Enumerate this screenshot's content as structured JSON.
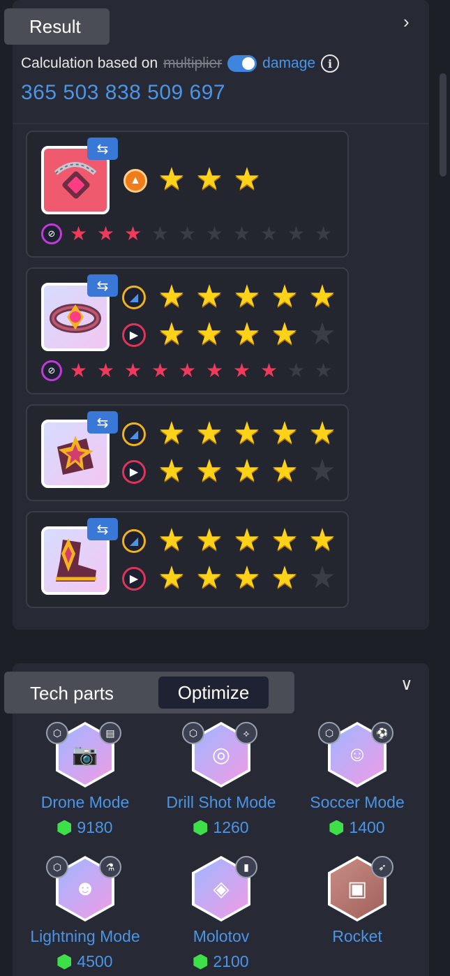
{
  "result": {
    "title": "Result",
    "calc_prefix": "Calculation based on",
    "calc_option_off": "multiplier",
    "calc_option_on": "damage",
    "info_icon": "i",
    "total": "365 503 838 509 697"
  },
  "items": [
    {
      "name": "chain-pendant",
      "stars_main": 3,
      "main_attr_icon": "fire-icon",
      "rows": [
        {
          "attr_icon": "flame-attr-icon",
          "filled": 3,
          "max": 3
        }
      ],
      "sub_stars": {
        "filled": 3,
        "max": 10
      }
    },
    {
      "name": "jeweled-collar",
      "rows": [
        {
          "attr_icon": "blade-attr-icon",
          "filled": 5,
          "max": 5
        },
        {
          "attr_icon": "speed-attr-icon",
          "filled": 4,
          "max": 5
        }
      ],
      "sub_stars": {
        "filled": 8,
        "max": 10
      }
    },
    {
      "name": "star-gauntlet",
      "rows": [
        {
          "attr_icon": "blade-attr-icon",
          "filled": 5,
          "max": 5
        },
        {
          "attr_icon": "speed-attr-icon",
          "filled": 4,
          "max": 5
        }
      ]
    },
    {
      "name": "winged-boot",
      "rows": [
        {
          "attr_icon": "blade-attr-icon",
          "filled": 5,
          "max": 5
        },
        {
          "attr_icon": "speed-attr-icon",
          "filled": 4,
          "max": 5
        }
      ]
    }
  ],
  "swap_symbol": "⇆",
  "tech": {
    "title": "Tech parts",
    "optimize_label": "Optimize",
    "parts": [
      {
        "name": "Drone Mode",
        "cost": "9180",
        "glyph": "📷",
        "badge": "▤"
      },
      {
        "name": "Drill Shot Mode",
        "cost": "1260",
        "glyph": "◎",
        "badge": "⟡"
      },
      {
        "name": "Soccer Mode",
        "cost": "1400",
        "glyph": "☺",
        "badge": "⚽"
      },
      {
        "name": "Lightning Mode",
        "cost": "4500",
        "glyph": "☻",
        "badge": "⚗"
      },
      {
        "name": "Molotov",
        "cost": "2100",
        "glyph": "◈",
        "badge": "▮"
      },
      {
        "name": "Rocket",
        "cost": "",
        "glyph": "▣",
        "badge": "➶"
      }
    ]
  }
}
